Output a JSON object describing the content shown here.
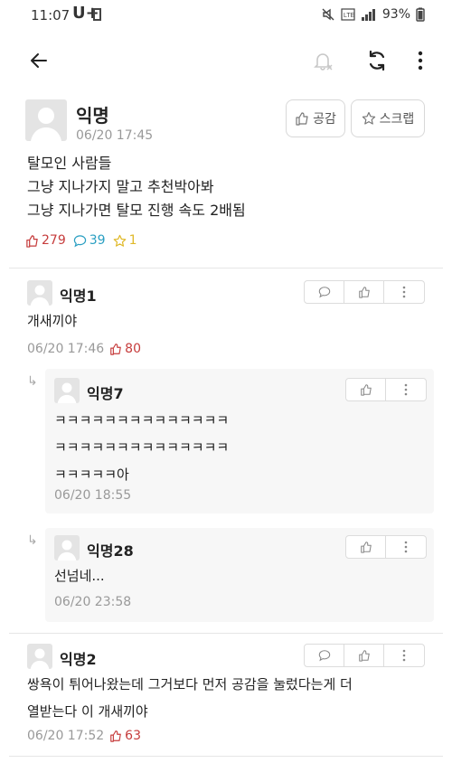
{
  "status_bar": {
    "time": "11:07",
    "carrier": "U+",
    "battery": "93%",
    "icons": [
      "mute-icon",
      "lte-icon",
      "signal-icon"
    ]
  },
  "toolbar": {
    "back_icon": "arrow-left-icon",
    "notify_icon": "bell-off-icon",
    "refresh_icon": "refresh-icon",
    "more_icon": "more-vertical-icon"
  },
  "article": {
    "author": "익명",
    "date": "06/20 17:45",
    "like_label": "공감",
    "scrap_label": "스크랩",
    "lines": [
      "탈모인 사람들",
      "그냥 지나가지 말고 추천박아봐",
      "그냥 지나가면 탈모 진행 속도 2배됨"
    ],
    "likes": "279",
    "comments": "39",
    "scraps": "1"
  },
  "comments": [
    {
      "author": "익명1",
      "lines": [
        "개새끼야"
      ],
      "date": "06/20 17:46",
      "likes": "80"
    },
    {
      "author": "익명7",
      "lines": [
        "ㅋㅋㅋㅋㅋㅋㅋㅋㅋㅋㅋㅋㅋㅋ",
        "ㅋㅋㅋㅋㅋㅋㅋㅋㅋㅋㅋㅋㅋㅋ",
        "ㅋㅋㅋㅋㅋ아"
      ],
      "date": "06/20 18:55",
      "is_reply": true
    },
    {
      "author": "익명28",
      "lines": [
        "선넘네..."
      ],
      "date": "06/20 23:58",
      "is_reply": true
    },
    {
      "author": "익명2",
      "lines": [
        "쌍욕이 튀어나왔는데 그거보다 먼저 공감을 눌렀다는게 더",
        "열받는다 이 개새끼야"
      ],
      "date": "06/20 17:52",
      "likes": "63"
    }
  ],
  "colors": {
    "like_red": "#c63c3c",
    "comment_blue": "#2a9fc2",
    "scrap_yellow": "#e0b92a",
    "reply_bg": "#f7f7f7"
  }
}
